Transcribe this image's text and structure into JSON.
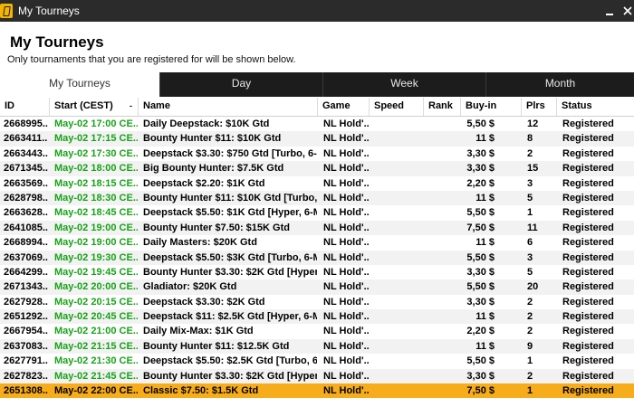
{
  "window": {
    "title": "My Tourneys",
    "icon": "poker-client-icon"
  },
  "page": {
    "heading": "My Tourneys",
    "subheading": "Only tournaments that you are registered for will be shown below."
  },
  "tabs": [
    {
      "label": "My Tourneys",
      "active": true
    },
    {
      "label": "Day",
      "active": false
    },
    {
      "label": "Week",
      "active": false
    },
    {
      "label": "Month",
      "active": false
    }
  ],
  "columns": {
    "id": "ID",
    "start": "Start (CEST)",
    "name": "Name",
    "game": "Game",
    "speed": "Speed",
    "rank": "Rank",
    "buyin": "Buy-in",
    "plrs": "Plrs",
    "status": "Status"
  },
  "colors": {
    "start_time": "#17a317",
    "selected_row": "#f7ad1b",
    "tab_bar": "#1c1c1c"
  },
  "rows": [
    {
      "id": "2668995..",
      "start": "May-02 17:00 CE..",
      "name": "Daily Deepstack: $10K Gtd",
      "game": "NL Hold'...",
      "speed": "",
      "rank": "",
      "buyin": "5,50 $",
      "plrs": "12",
      "status": "Registered"
    },
    {
      "id": "2663411..",
      "start": "May-02 17:15 CE..",
      "name": "Bounty Hunter $11: $10K Gtd",
      "game": "NL Hold'...",
      "speed": "",
      "rank": "",
      "buyin": "11 $",
      "plrs": "8",
      "status": "Registered"
    },
    {
      "id": "2663443..",
      "start": "May-02 17:30 CE..",
      "name": "Deepstack $3.30: $750 Gtd [Turbo, 6-...",
      "game": "NL Hold'...",
      "speed": "",
      "rank": "",
      "buyin": "3,30 $",
      "plrs": "2",
      "status": "Registered"
    },
    {
      "id": "2671345..",
      "start": "May-02 18:00 CE..",
      "name": "Big Bounty Hunter: $7.5K Gtd",
      "game": "NL Hold'...",
      "speed": "",
      "rank": "",
      "buyin": "3,30 $",
      "plrs": "15",
      "status": "Registered"
    },
    {
      "id": "2663569..",
      "start": "May-02 18:15 CE..",
      "name": "Deepstack $2.20: $1K Gtd",
      "game": "NL Hold'...",
      "speed": "",
      "rank": "",
      "buyin": "2,20 $",
      "plrs": "3",
      "status": "Registered"
    },
    {
      "id": "2628798..",
      "start": "May-02 18:30 CE..",
      "name": "Bounty Hunter $11: $10K Gtd [Turbo, ...",
      "game": "NL Hold'...",
      "speed": "",
      "rank": "",
      "buyin": "11 $",
      "plrs": "5",
      "status": "Registered"
    },
    {
      "id": "2663628..",
      "start": "May-02 18:45 CE..",
      "name": "Deepstack $5.50: $1K Gtd [Hyper, 6-M...",
      "game": "NL Hold'...",
      "speed": "",
      "rank": "",
      "buyin": "5,50 $",
      "plrs": "1",
      "status": "Registered"
    },
    {
      "id": "2641085..",
      "start": "May-02 19:00 CE..",
      "name": "Bounty Hunter $7.50: $15K Gtd",
      "game": "NL Hold'...",
      "speed": "",
      "rank": "",
      "buyin": "7,50 $",
      "plrs": "11",
      "status": "Registered"
    },
    {
      "id": "2668994..",
      "start": "May-02 19:00 CE..",
      "name": "Daily Masters: $20K Gtd",
      "game": "NL Hold'...",
      "speed": "",
      "rank": "",
      "buyin": "11 $",
      "plrs": "6",
      "status": "Registered"
    },
    {
      "id": "2637069..",
      "start": "May-02 19:30 CE..",
      "name": "Deepstack $5.50: $3K Gtd [Turbo, 6-M...",
      "game": "NL Hold'...",
      "speed": "",
      "rank": "",
      "buyin": "5,50 $",
      "plrs": "3",
      "status": "Registered"
    },
    {
      "id": "2664299..",
      "start": "May-02 19:45 CE..",
      "name": "Bounty Hunter $3.30: $2K Gtd [Hyper, ...",
      "game": "NL Hold'...",
      "speed": "",
      "rank": "",
      "buyin": "3,30 $",
      "plrs": "5",
      "status": "Registered"
    },
    {
      "id": "2671343..",
      "start": "May-02 20:00 CE..",
      "name": "Gladiator: $20K Gtd",
      "game": "NL Hold'...",
      "speed": "",
      "rank": "",
      "buyin": "5,50 $",
      "plrs": "20",
      "status": "Registered"
    },
    {
      "id": "2627928..",
      "start": "May-02 20:15 CE..",
      "name": "Deepstack $3.30: $2K Gtd",
      "game": "NL Hold'...",
      "speed": "",
      "rank": "",
      "buyin": "3,30 $",
      "plrs": "2",
      "status": "Registered"
    },
    {
      "id": "2651292..",
      "start": "May-02 20:45 CE..",
      "name": "Deepstack $11: $2.5K Gtd [Hyper, 6-M...",
      "game": "NL Hold'...",
      "speed": "",
      "rank": "",
      "buyin": "11 $",
      "plrs": "2",
      "status": "Registered"
    },
    {
      "id": "2667954..",
      "start": "May-02 21:00 CE..",
      "name": "Daily Mix-Max: $1K Gtd",
      "game": "NL Hold'...",
      "speed": "",
      "rank": "",
      "buyin": "2,20 $",
      "plrs": "2",
      "status": "Registered"
    },
    {
      "id": "2637083..",
      "start": "May-02 21:15 CE..",
      "name": "Bounty Hunter $11: $12.5K Gtd",
      "game": "NL Hold'...",
      "speed": "",
      "rank": "",
      "buyin": "11 $",
      "plrs": "9",
      "status": "Registered"
    },
    {
      "id": "2627791..",
      "start": "May-02 21:30 CE..",
      "name": "Deepstack $5.50: $2.5K Gtd [Turbo, 6-...",
      "game": "NL Hold'...",
      "speed": "",
      "rank": "",
      "buyin": "5,50 $",
      "plrs": "1",
      "status": "Registered"
    },
    {
      "id": "2627823..",
      "start": "May-02 21:45 CE..",
      "name": "Bounty Hunter $3.30: $2K Gtd [Hyper, ...",
      "game": "NL Hold'...",
      "speed": "",
      "rank": "",
      "buyin": "3,30 $",
      "plrs": "2",
      "status": "Registered"
    },
    {
      "id": "2651308..",
      "start": "May-02 22:00 CE..",
      "name": "Classic $7.50: $1.5K Gtd",
      "game": "NL Hold'...",
      "speed": "",
      "rank": "",
      "buyin": "7,50 $",
      "plrs": "1",
      "status": "Registered",
      "selected": true
    }
  ]
}
